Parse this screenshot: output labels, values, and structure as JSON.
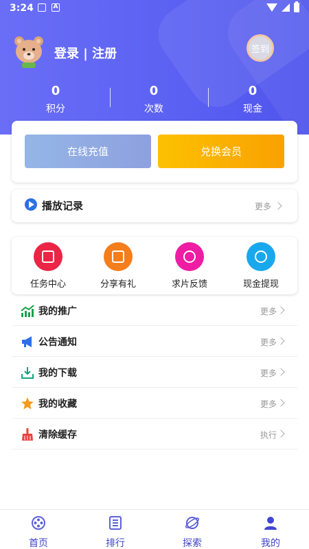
{
  "status": {
    "time": "3:24"
  },
  "profile": {
    "login_text": "登录 | 注册",
    "signin_label": "签到"
  },
  "stats": [
    {
      "value": "0",
      "label": "积分"
    },
    {
      "value": "0",
      "label": "次数"
    },
    {
      "value": "0",
      "label": "现金"
    }
  ],
  "actions": {
    "recharge": "在线充值",
    "member": "兑换会员"
  },
  "history": {
    "label": "播放记录",
    "more": "更多"
  },
  "grid": [
    {
      "label": "任务中心",
      "icon": "task-icon",
      "color": "#eb2546"
    },
    {
      "label": "分享有礼",
      "icon": "gift-icon",
      "color": "#f47d1c"
    },
    {
      "label": "求片反馈",
      "icon": "feedback-icon",
      "color": "#ee1da3"
    },
    {
      "label": "现金提现",
      "icon": "money-bag-icon",
      "color": "#19a8ee"
    }
  ],
  "list": [
    {
      "label": "我的推广",
      "action": "更多",
      "icon": "chart-icon",
      "color": "#17a34a"
    },
    {
      "label": "公告通知",
      "action": "更多",
      "icon": "megaphone-icon",
      "color": "#2d6fe6"
    },
    {
      "label": "我的下载",
      "action": "更多",
      "icon": "download-icon",
      "color": "#14a37f"
    },
    {
      "label": "我的收藏",
      "action": "更多",
      "icon": "star-icon",
      "color": "#f59b1d"
    },
    {
      "label": "清除缓存",
      "action": "执行",
      "icon": "broom-icon",
      "color": "#e8443a"
    }
  ],
  "nav": [
    {
      "label": "首页",
      "icon": "home-film-icon"
    },
    {
      "label": "排行",
      "icon": "ranking-icon"
    },
    {
      "label": "探索",
      "icon": "explore-icon"
    },
    {
      "label": "我的",
      "icon": "user-icon"
    }
  ],
  "colors": {
    "header": "#5a60f2",
    "accent": "#3f44c8"
  }
}
